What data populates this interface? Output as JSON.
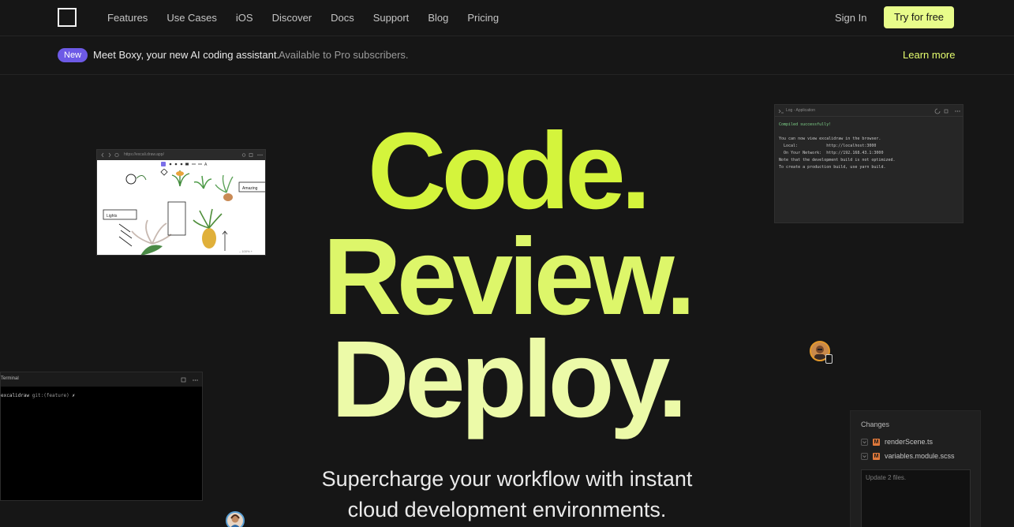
{
  "nav": {
    "links": [
      "Features",
      "Use Cases",
      "iOS",
      "Discover",
      "Docs",
      "Support",
      "Blog",
      "Pricing"
    ],
    "sign_in": "Sign In",
    "try_free": "Try for free"
  },
  "announcement": {
    "badge": "New",
    "message": "Meet Boxy, your new AI coding assistant.",
    "sub": "Available to Pro subscribers.",
    "link": "Learn more"
  },
  "hero": {
    "line1": "Code.",
    "line2": "Review.",
    "line3": "Deploy.",
    "subtitle_line1": "Supercharge your workflow with instant",
    "subtitle_line2": "cloud development environments."
  },
  "sketch_window": {
    "url": "https://excali.draw.app/",
    "label_left": "Lights",
    "label_right": "Amazing"
  },
  "log_window": {
    "title": "Log - Application",
    "compiled": "Compiled successfully!",
    "lines": [
      "You can now view excalidraw in the browser.",
      "",
      "  Local:            http://localhost:3000",
      "  On Your Network:  http://192.168.43.1:3000",
      "",
      "Note that the development build is not optimized.",
      "To create a production build, use yarn build."
    ]
  },
  "terminal": {
    "title": "Terminal",
    "prompt_dir": "excalidraw",
    "prompt_git": "git:(feature)",
    "prompt_mark": "✗"
  },
  "changes": {
    "title": "Changes",
    "files": [
      {
        "badge": "M",
        "name": "renderScene.ts"
      },
      {
        "badge": "M",
        "name": "variables.module.scss"
      }
    ],
    "commit_placeholder": "Update 2 files."
  },
  "colors": {
    "accent": "#e8fc8a",
    "badge": "#6d5ae6",
    "background": "#161616"
  }
}
